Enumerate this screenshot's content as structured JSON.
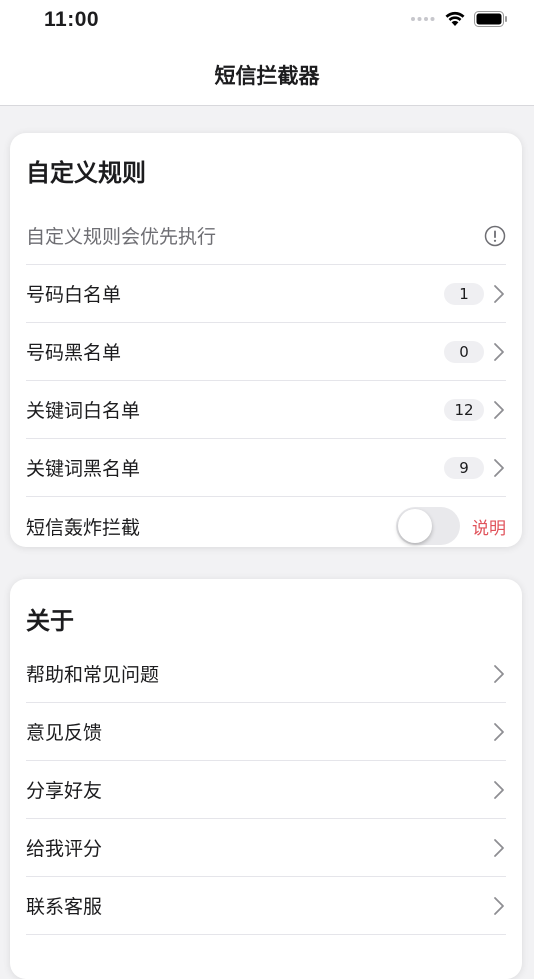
{
  "status_bar": {
    "time": "11:00"
  },
  "nav": {
    "title": "短信拦截器"
  },
  "rules_card": {
    "title": "自定义规则",
    "note": "自定义规则会优先执行",
    "items": [
      {
        "label": "号码白名单",
        "count": "1"
      },
      {
        "label": "号码黑名单",
        "count": "0"
      },
      {
        "label": "关键词白名单",
        "count": "12"
      },
      {
        "label": "关键词黑名单",
        "count": "9"
      }
    ],
    "bombing": {
      "label": "短信轰炸拦截",
      "enabled": false,
      "explain_label": "说明"
    }
  },
  "about_card": {
    "title": "关于",
    "items": [
      {
        "label": "帮助和常见问题"
      },
      {
        "label": "意见反馈"
      },
      {
        "label": "分享好友"
      },
      {
        "label": "给我评分"
      },
      {
        "label": "联系客服"
      }
    ]
  },
  "colors": {
    "accent": "#e0525a",
    "background": "#f2f2f4"
  },
  "icons": [
    "wifi-icon",
    "battery-icon",
    "info-circle-icon",
    "chevron-right-icon"
  ]
}
